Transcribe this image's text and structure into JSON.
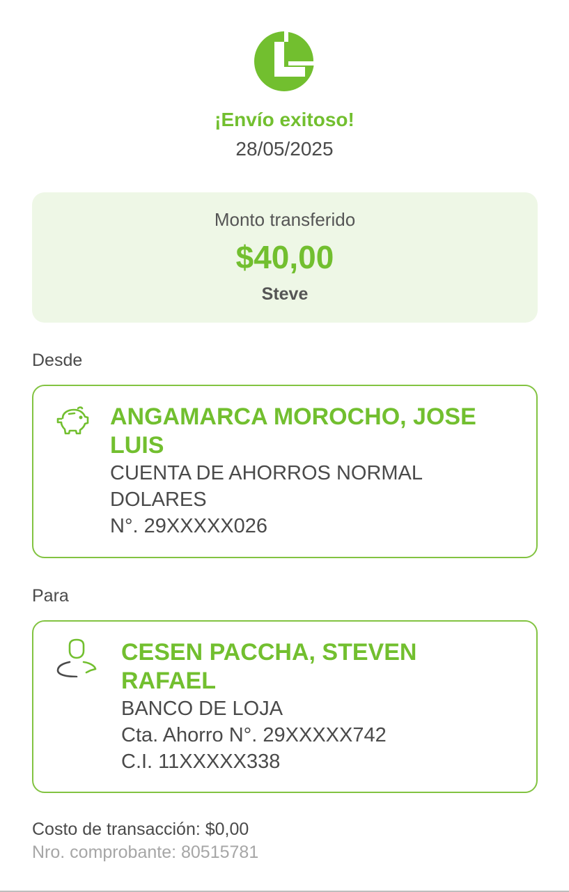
{
  "header": {
    "logo_icon": "bank-logo-icon",
    "title": "¡Envío exitoso!",
    "date": "28/05/2025"
  },
  "amount": {
    "label": "Monto transferido",
    "value": "$40,00",
    "description": "Steve"
  },
  "from": {
    "label": "Desde",
    "icon": "piggy-bank-icon",
    "name_line1": "ANGAMARCA MOROCHO, JOSE",
    "name_line2": "LUIS",
    "account_line1": "CUENTA DE AHORROS NORMAL",
    "account_line2": "DOLARES",
    "account_number": "N°. 29XXXXX026"
  },
  "to": {
    "label": "Para",
    "icon": "user-icon",
    "name_line1": "CESEN PACCHA, STEVEN",
    "name_line2": "RAFAEL",
    "bank": "BANCO DE LOJA",
    "account": "Cta. Ahorro N°. 29XXXXX742",
    "id": "C.I. 11XXXXX338"
  },
  "footer": {
    "cost": "Costo de transacción: $0,00",
    "receipt": "Nro. comprobante: 80515781"
  },
  "colors": {
    "accent": "#72bf2f",
    "card_bg": "#eef7e6",
    "border": "#82c341",
    "text": "#4a4a4a",
    "muted": "#a6a6a6"
  }
}
